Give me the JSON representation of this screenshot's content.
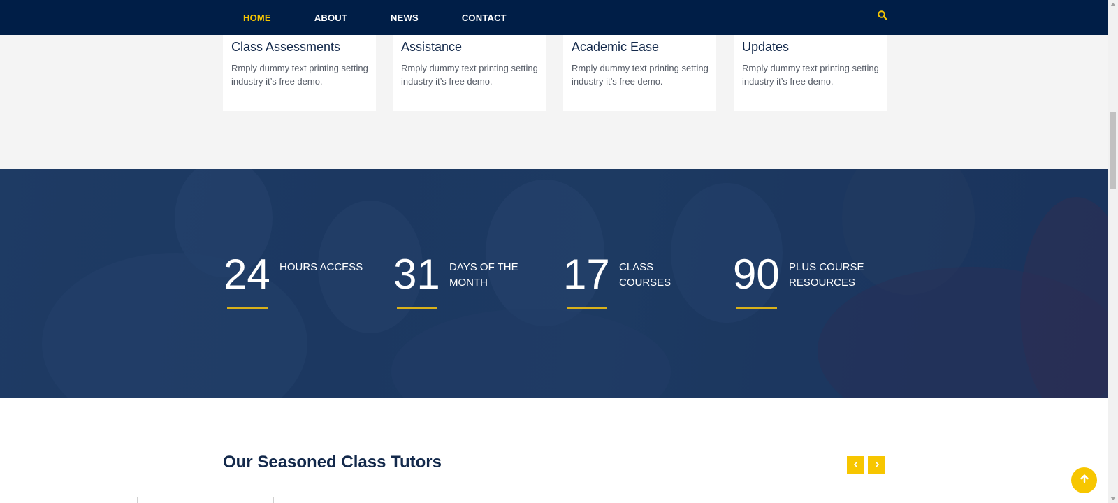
{
  "nav": {
    "items": [
      {
        "label": "HOME",
        "active": true
      },
      {
        "label": "ABOUT",
        "active": false
      },
      {
        "label": "NEWS",
        "active": false
      },
      {
        "label": "CONTACT",
        "active": false
      }
    ],
    "divider": "|",
    "search_icon": "search-icon"
  },
  "features": [
    {
      "title": "Class Assessments",
      "text": "Rmply dummy text printing setting industry it’s free demo."
    },
    {
      "title": "Assistance",
      "text": "Rmply dummy text printing setting industry it’s free demo."
    },
    {
      "title": "Academic Ease",
      "text": "Rmply dummy text printing setting industry it’s free demo."
    },
    {
      "title": "Updates",
      "text": "Rmply dummy text printing setting industry it’s free demo."
    }
  ],
  "stats": [
    {
      "number": "24",
      "label": "HOURS ACCESS"
    },
    {
      "number": "31",
      "label": "DAYS OF THE MONTH"
    },
    {
      "number": "17",
      "label": "CLASS COURSES"
    },
    {
      "number": "90",
      "label": "PLUS COURSE RESOURCES"
    }
  ],
  "tutors": {
    "title": "Our Seasoned Class Tutors",
    "prev_icon": "chevron-left-icon",
    "next_icon": "chevron-right-icon"
  },
  "scroll_top_icon": "arrow-up-icon",
  "colors": {
    "navy": "#001e47",
    "accent": "#f7c600",
    "heading": "#13294b",
    "stats_overlay": "#1e3c63"
  }
}
